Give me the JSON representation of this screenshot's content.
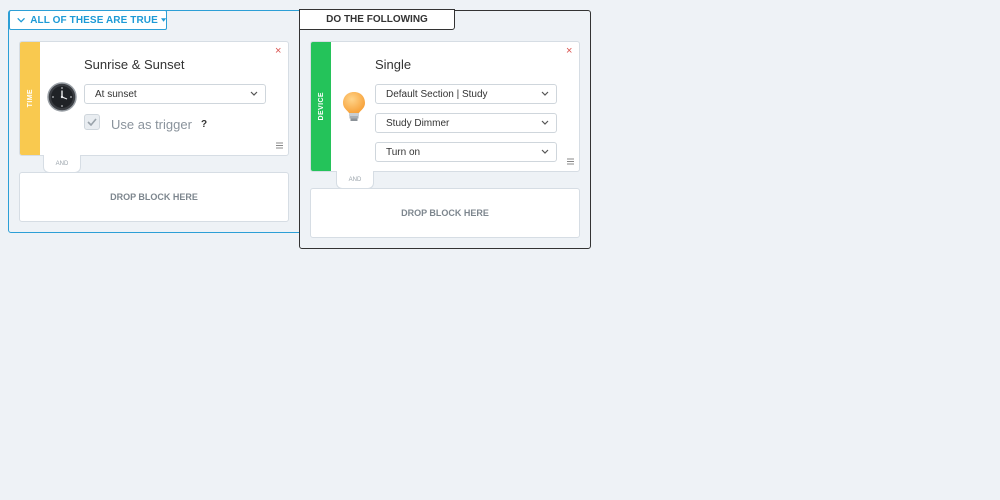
{
  "conditions": {
    "header_label": "ALL OF THESE ARE TRUE",
    "block": {
      "category": "TIME",
      "icon": "clock-icon",
      "title": "Sunrise & Sunset",
      "select_value": "At sunset",
      "use_as_trigger_label": "Use as trigger",
      "use_as_trigger_checked": true,
      "help_label": "?",
      "close_label": "×",
      "connector_label": "AND"
    },
    "drop_label": "DROP BLOCK HERE"
  },
  "actions": {
    "header_label": "DO THE FOLLOWING",
    "block": {
      "category": "DEVICE",
      "icon": "light-bulb-icon",
      "title": "Single",
      "select_1_value": "Default Section | Study",
      "select_2_value": "Study Dimmer",
      "select_3_value": "Turn on",
      "close_label": "×",
      "connector_label": "AND"
    },
    "drop_label": "DROP BLOCK HERE"
  },
  "colors": {
    "conditions_accent": "#2c9fd6",
    "time_stripe": "#f9c94f",
    "device_stripe": "#24c35a",
    "close": "#d9534f"
  }
}
